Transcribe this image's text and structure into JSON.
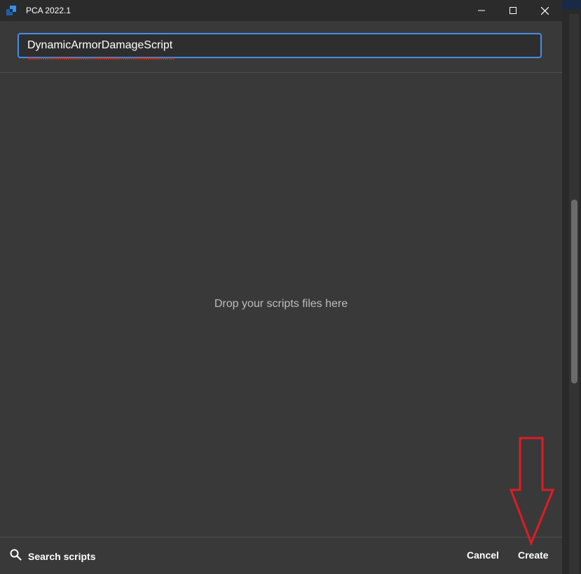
{
  "window": {
    "title": "PCA 2022.1",
    "controls": {
      "minimize_icon": "minimize-icon",
      "maximize_icon": "maximize-icon",
      "close_icon": "close-icon"
    }
  },
  "script_name_input": {
    "value": "DynamicArmorDamageScript",
    "focus_color": "#4a8ce6"
  },
  "drop_zone": {
    "text": "Drop your scripts files here"
  },
  "footer": {
    "search_icon": "search-icon",
    "search_label": "Search scripts",
    "cancel_label": "Cancel",
    "create_label": "Create"
  },
  "annotation": {
    "type": "arrow-down",
    "color": "#e01b24"
  },
  "colors": {
    "background": "#393939",
    "titlebar": "#2b2b2b",
    "text": "#ffffff",
    "muted_text": "#bdbdbd"
  }
}
